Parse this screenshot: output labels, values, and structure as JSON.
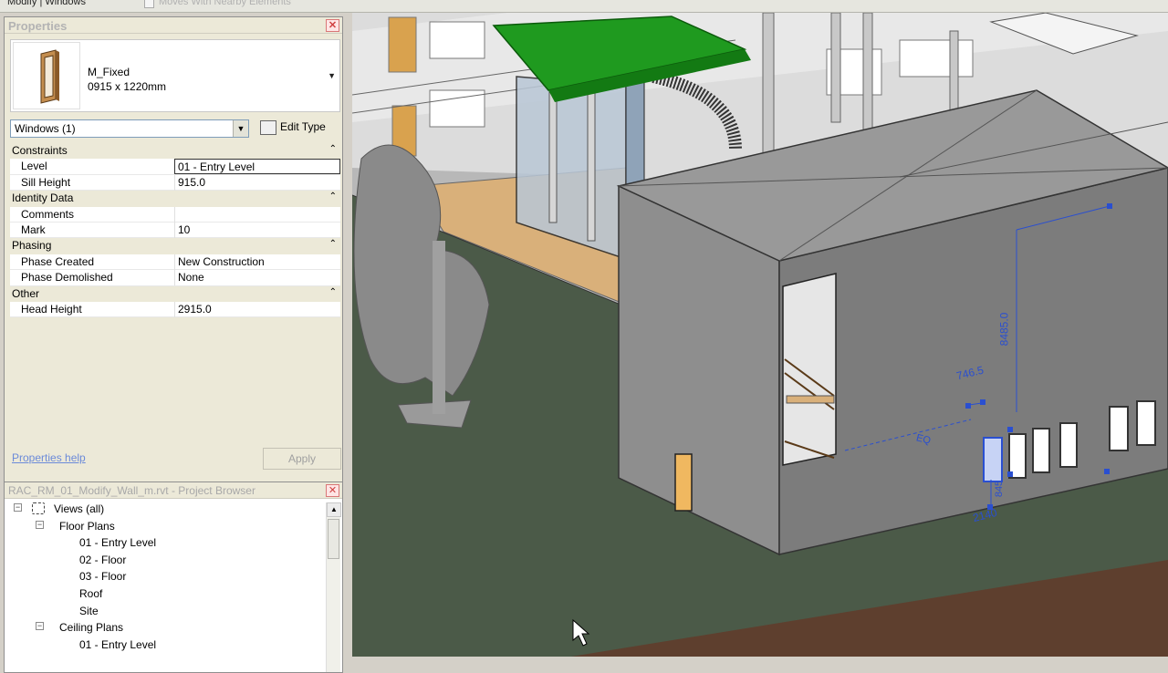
{
  "ribbon": {
    "context_label": "Modify | Windows",
    "checkbox_label": "Moves With Nearby Elements"
  },
  "properties": {
    "title": "Properties",
    "type_name": "M_Fixed",
    "type_size": "0915 x 1220mm",
    "filter_value": "Windows (1)",
    "edit_type_label": "Edit Type",
    "help_link": "Properties help",
    "apply_label": "Apply",
    "groups": [
      {
        "name": "Constraints",
        "rows": [
          {
            "key": "Level",
            "value": "01 - Entry Level",
            "active": true
          },
          {
            "key": "Sill Height",
            "value": "915.0"
          }
        ]
      },
      {
        "name": "Identity Data",
        "rows": [
          {
            "key": "Comments",
            "value": ""
          },
          {
            "key": "Mark",
            "value": "10"
          }
        ]
      },
      {
        "name": "Phasing",
        "rows": [
          {
            "key": "Phase Created",
            "value": "New Construction"
          },
          {
            "key": "Phase Demolished",
            "value": "None"
          }
        ]
      },
      {
        "name": "Other",
        "rows": [
          {
            "key": "Head Height",
            "value": "2915.0"
          }
        ]
      }
    ]
  },
  "browser": {
    "title": "RAC_RM_01_Modify_Wall_m.rvt - Project Browser",
    "root": "Views (all)",
    "floor_plans_label": "Floor Plans",
    "floor_plans": [
      "01 - Entry Level",
      "02 - Floor",
      "03 - Floor",
      "Roof",
      "Site"
    ],
    "ceiling_plans_label": "Ceiling Plans",
    "ceiling_plans": [
      "01 - Entry Level"
    ]
  },
  "viewport": {
    "dimensions": [
      "746.5",
      "EQ",
      "8485.0",
      "2140",
      "845"
    ]
  },
  "colors": {
    "canopy": "#1f9a1f",
    "ground": "#4b5a48",
    "wall": "#8e8e8e",
    "dimension": "#2a4fd0",
    "door": "#f0b860"
  }
}
